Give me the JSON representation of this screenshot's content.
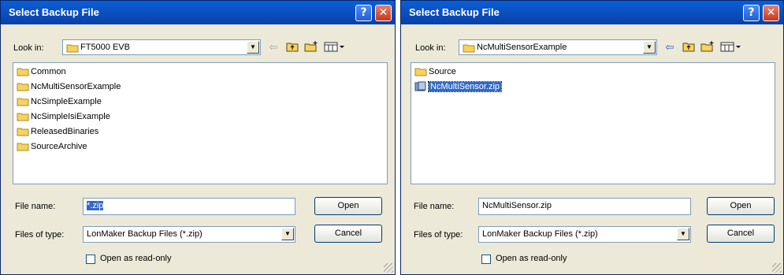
{
  "dialogs": [
    {
      "title": "Select Backup File",
      "help_glyph": "?",
      "close_glyph": "✕",
      "look_in_label": "Look in:",
      "look_in_value": "FT5000 EVB",
      "items": [
        {
          "name": "Common",
          "type": "folder"
        },
        {
          "name": "NcMultiSensorExample",
          "type": "folder"
        },
        {
          "name": "NcSimpleExample",
          "type": "folder"
        },
        {
          "name": "NcSimpleIsiExample",
          "type": "folder"
        },
        {
          "name": "ReleasedBinaries",
          "type": "folder"
        },
        {
          "name": "SourceArchive",
          "type": "folder"
        }
      ],
      "file_name_label": "File name:",
      "file_name_value": "*.zip",
      "file_name_selected": true,
      "files_of_type_label": "Files of type:",
      "files_of_type_value": "LonMaker Backup Files  (*.zip)",
      "open_label": "Open",
      "cancel_label": "Cancel",
      "readonly_label": "Open as read-only",
      "back_enabled": false
    },
    {
      "title": "Select Backup File",
      "help_glyph": "?",
      "close_glyph": "✕",
      "look_in_label": "Look in:",
      "look_in_value": "NcMultiSensorExample",
      "items": [
        {
          "name": "Source",
          "type": "folder"
        },
        {
          "name": "NcMultiSensor.zip",
          "type": "zip",
          "selected": true
        }
      ],
      "file_name_label": "File name:",
      "file_name_value": "NcMultiSensor.zip",
      "file_name_selected": false,
      "files_of_type_label": "Files of type:",
      "files_of_type_value": "LonMaker Backup Files  (*.zip)",
      "open_label": "Open",
      "cancel_label": "Cancel",
      "readonly_label": "Open as read-only",
      "back_enabled": true
    }
  ],
  "colors": {
    "title_bar": "#0b53c4",
    "selection": "#316ac5",
    "dialog_bg": "#ece9d8"
  },
  "icons": {
    "back": "back-arrow-icon",
    "up": "up-folder-icon",
    "new_folder": "new-folder-icon",
    "views": "views-menu-icon"
  }
}
